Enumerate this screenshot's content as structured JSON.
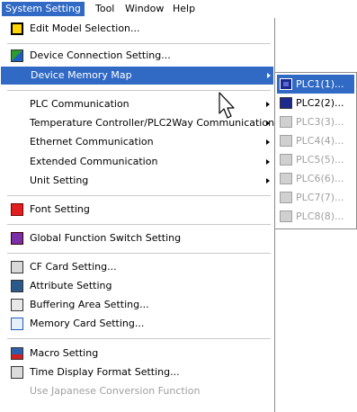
{
  "menubar": [
    "System Setting",
    "Tool",
    "Window",
    "Help"
  ],
  "menu": {
    "items": [
      {
        "label": "Edit Model Selection...",
        "icon": "edit-model-icon"
      },
      {
        "label": "Device Connection Setting...",
        "icon": "device-connection-icon"
      },
      {
        "label": "Device Memory Map",
        "submenu": true
      },
      {
        "label": "PLC Communication",
        "submenu": true
      },
      {
        "label": "Temperature Controller/PLC2Way Communication",
        "submenu": true
      },
      {
        "label": "Ethernet Communication",
        "submenu": true
      },
      {
        "label": "Extended Communication",
        "submenu": true
      },
      {
        "label": "Unit Setting",
        "submenu": true
      },
      {
        "label": "Font Setting",
        "icon": "font-icon"
      },
      {
        "label": "Global Function Switch Setting",
        "icon": "global-function-icon"
      },
      {
        "label": "CF Card Setting...",
        "icon": "cf-card-icon"
      },
      {
        "label": "Attribute Setting",
        "icon": "attribute-icon"
      },
      {
        "label": "Buffering Area Setting...",
        "icon": "buffering-icon"
      },
      {
        "label": "Memory Card Setting...",
        "icon": "memory-card-icon"
      },
      {
        "label": "Macro Setting",
        "icon": "macro-icon"
      },
      {
        "label": "Time Display Format Setting...",
        "icon": "time-display-icon"
      },
      {
        "label": "Use Japanese Conversion Function",
        "disabled": true
      }
    ]
  },
  "submenu": {
    "items": [
      "PLC1(1)...",
      "PLC2(2)...",
      "PLC3(3)...",
      "PLC4(4)...",
      "PLC5(5)...",
      "PLC6(6)...",
      "PLC7(7)...",
      "PLC8(8)..."
    ]
  },
  "colors": {
    "highlight": "#316ac5",
    "disabled": "#a0a0a0"
  }
}
